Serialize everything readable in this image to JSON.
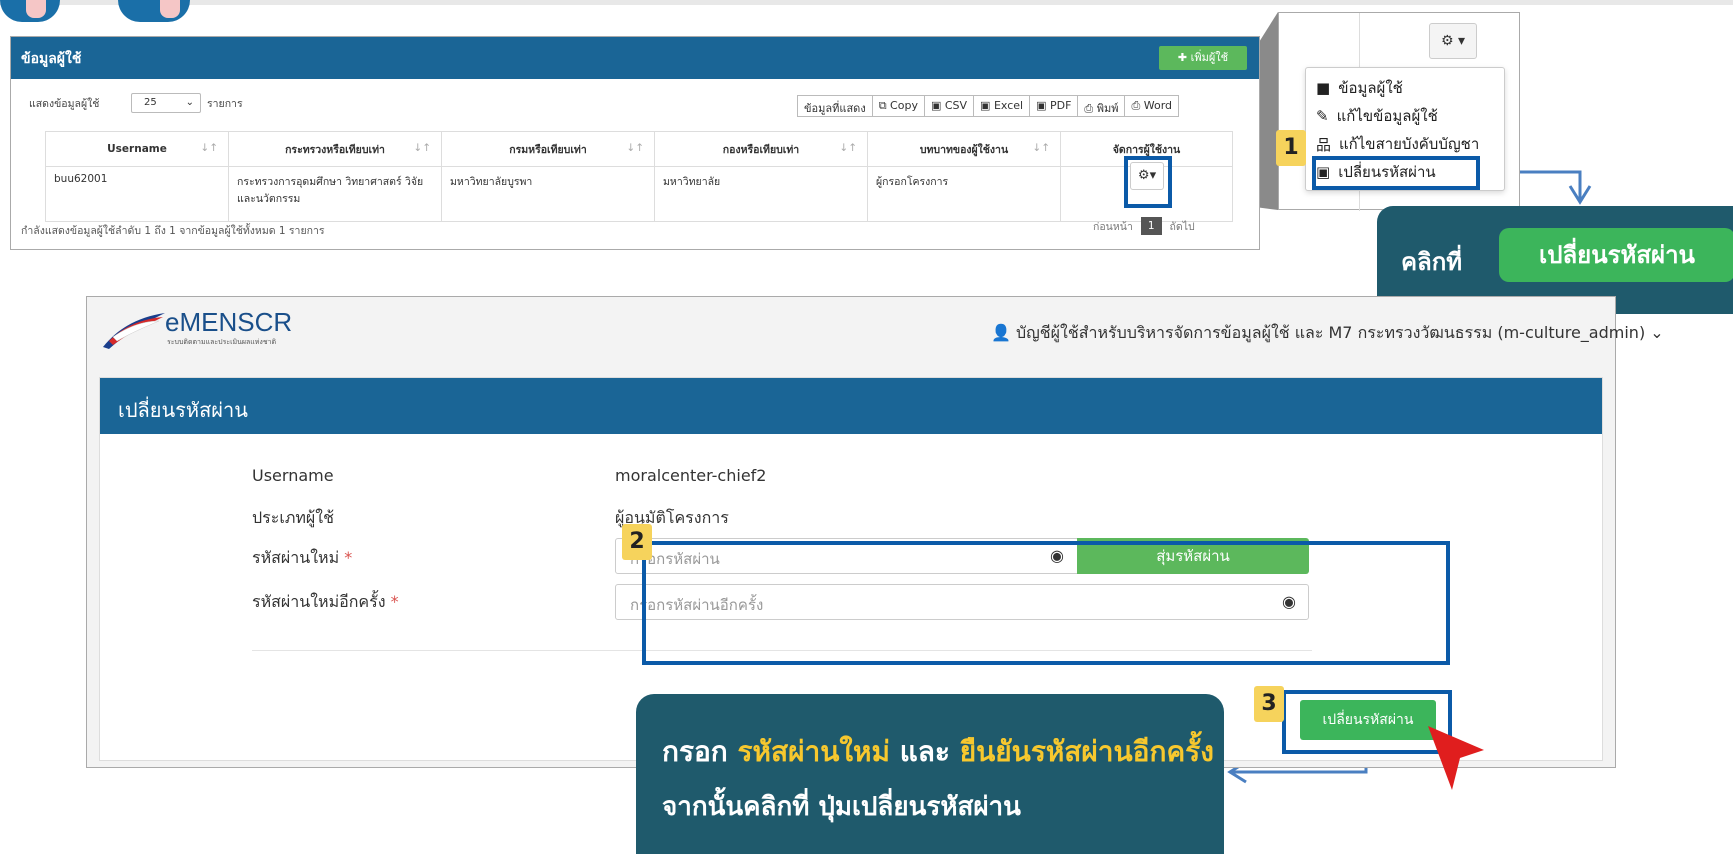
{
  "colors": {
    "primary": "#1a6596",
    "success": "#5cb85c",
    "highlight": "#0b5aa8",
    "callout": "#1f5a6c",
    "number_badge": "#f6d35c",
    "emphasis": "#f7c82e"
  },
  "panel1": {
    "title": "ข้อมูลผู้ใช้",
    "add_button": "เพิ่มผู้ใช้",
    "show_label": "แสดงข้อมูลผู้ใช้",
    "page_length": "25",
    "page_length_unit": "รายการ",
    "export_buttons": [
      "ข้อมูลที่แสดง",
      "Copy",
      "CSV",
      "Excel",
      "PDF",
      "พิมพ์",
      "Word"
    ],
    "columns": [
      "Username",
      "กระทรวงหรือเทียบเท่า",
      "กรมหรือเทียบเท่า",
      "กองหรือเทียบเท่า",
      "บทบาทของผู้ใช้งาน",
      "จัดการผู้ใช้งาน"
    ],
    "rows": [
      {
        "username": "buu62001",
        "ministry": "กระทรวงการอุดมศึกษา วิทยาศาสตร์ วิจัยและนวัตกรรม",
        "department": "มหาวิทยาลัยบูรพา",
        "division": "มหาวิทยาลัย",
        "role": "ผู้กรอกโครงการ"
      }
    ],
    "footer_info": "กำลังแสดงข้อมูลผู้ใช้ลำดับ 1 ถึง 1 จากข้อมูลผู้ใช้ทั้งหมด 1 รายการ",
    "pager": {
      "prev": "ก่อนหน้า",
      "current": "1",
      "next": "ถัดไป"
    }
  },
  "zoom_menu": {
    "items": [
      "ข้อมูลผู้ใช้",
      "แก้ไขข้อมูลผู้ใช้",
      "แก้ไขสายบังคับบัญชา",
      "เปลี่ยนรหัสผ่าน"
    ]
  },
  "steps": [
    "1",
    "2",
    "3"
  ],
  "callout1": {
    "label": "คลิกที่",
    "pill": "เปลี่ยนรหัสผ่าน"
  },
  "panel2": {
    "logo_text": "eMENSCR",
    "logo_sub": "ระบบติดตามและประเมินผลแห่งชาติ",
    "account": "บัญชีผู้ใช้สำหรับบริหารจัดการข้อมูลผู้ใช้ และ M7 กระทรวงวัฒนธรรม (m-culture_admin)",
    "card_title": "เปลี่ยนรหัสผ่าน",
    "fields": {
      "username_label": "Username",
      "username_value": "moralcenter-chief2",
      "type_label": "ประเภทผู้ใช้",
      "type_value": "ผู้อนุมัติโครงการ",
      "new_password_label": "รหัสผ่านใหม่",
      "new_password_placeholder": "กรอกรหัสผ่าน",
      "confirm_label": "รหัสผ่านใหม่อีกครั้ง",
      "confirm_placeholder": "กรอกรหัสผ่านอีกครั้ง",
      "required_mark": "*"
    },
    "random_button": "สุ่มรหัสผ่าน",
    "submit_button": "เปลี่ยนรหัสผ่าน"
  },
  "callout2": {
    "prefix": "กรอก",
    "new_password": "รหัสผ่านใหม่",
    "and": "และ",
    "confirm": "ยืนยันรหัสผ่านอีกครั้ง",
    "line2": "จากนั้นคลิกที่ ปุ่มเปลี่ยนรหัสผ่าน"
  }
}
